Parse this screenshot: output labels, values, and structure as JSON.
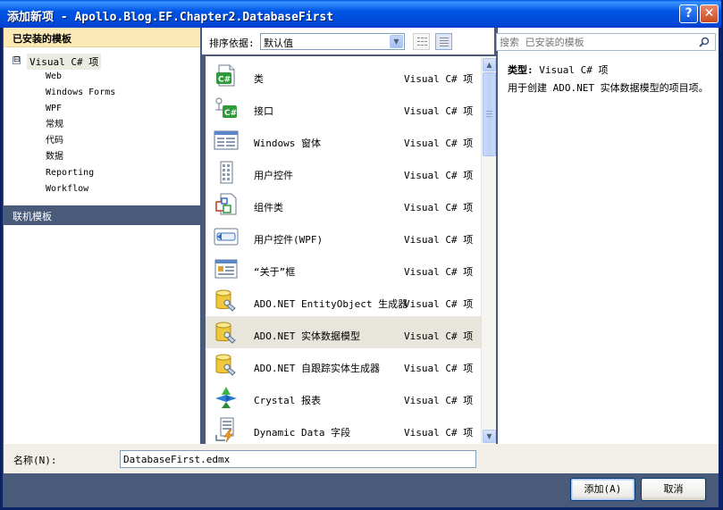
{
  "window": {
    "title": "添加新项 - Apollo.Blog.EF.Chapter2.DatabaseFirst",
    "help_label": "?",
    "close_label": "✕"
  },
  "left_pane": {
    "header": "已安装的模板",
    "tree_root": {
      "toggle": "⊟",
      "label": "Visual C# 项"
    },
    "tree_children": [
      "Web",
      "Windows Forms",
      "WPF",
      "常规",
      "代码",
      "数据",
      "Reporting",
      "Workflow"
    ],
    "online_label": "联机模板"
  },
  "toolbar": {
    "sort_label": "排序依据:",
    "sort_value": "默认值",
    "dropdown_arrow": "▼"
  },
  "items": [
    {
      "name": "类",
      "category": "Visual C# 项",
      "icon": "csharp-class-icon"
    },
    {
      "name": "接口",
      "category": "Visual C# 项",
      "icon": "csharp-interface-icon"
    },
    {
      "name": "Windows 窗体",
      "category": "Visual C# 项",
      "icon": "windows-form-icon"
    },
    {
      "name": "用户控件",
      "category": "Visual C# 项",
      "icon": "user-control-icon"
    },
    {
      "name": "组件类",
      "category": "Visual C# 项",
      "icon": "component-class-icon"
    },
    {
      "name": "用户控件(WPF)",
      "category": "Visual C# 项",
      "icon": "wpf-user-control-icon"
    },
    {
      "name": "“关于”框",
      "category": "Visual C# 项",
      "icon": "about-box-icon"
    },
    {
      "name": "ADO.NET EntityObject 生成器",
      "category": "Visual C# 项",
      "icon": "database-generator-icon"
    },
    {
      "name": "ADO.NET 实体数据模型",
      "category": "Visual C# 项",
      "icon": "entity-data-model-icon",
      "selected": true
    },
    {
      "name": "ADO.NET 自跟踪实体生成器",
      "category": "Visual C# 项",
      "icon": "self-tracking-generator-icon"
    },
    {
      "name": "Crystal 报表",
      "category": "Visual C# 项",
      "icon": "crystal-report-icon"
    },
    {
      "name": "Dynamic Data 字段",
      "category": "Visual C# 项",
      "icon": "dynamic-data-field-icon"
    }
  ],
  "scrollbar": {
    "up": "▲",
    "down": "▼"
  },
  "right_pane": {
    "search_placeholder": "搜索 已安装的模板",
    "type_label": "类型:",
    "type_value": "Visual C# 项",
    "description": "用于创建 ADO.NET 实体数据模型的项目项。"
  },
  "name_row": {
    "label": "名称(N):",
    "value": "DatabaseFirst.edmx"
  },
  "buttons": {
    "add": "添加(A)",
    "cancel": "取消"
  },
  "colors": {
    "titlebar": "#0055e5",
    "left_header_bg": "#fbe9b6",
    "online_bg": "#4a5a7a",
    "selected_row": "#e8e6dc"
  }
}
